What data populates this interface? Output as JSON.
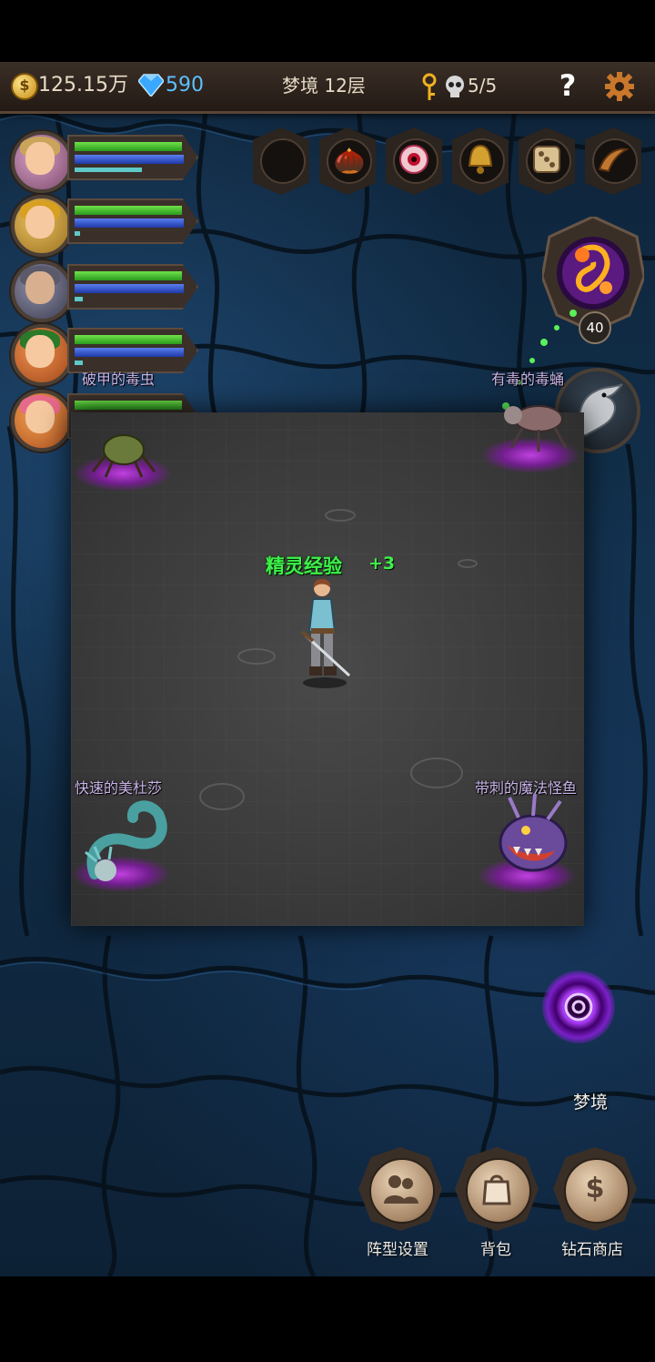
{
  "topbar": {
    "gold": "125.15万",
    "diamonds": "590",
    "floor": "梦境 12层",
    "keys": "5/5",
    "help": "?"
  },
  "party": {
    "heroes": [
      {
        "name": "hero-1",
        "hp": 0.95,
        "mp": 0.98,
        "xp": 0.55
      },
      {
        "name": "hero-2",
        "hp": 0.95,
        "mp": 0.98,
        "xp": 0.05
      },
      {
        "name": "hero-3",
        "hp": 0.95,
        "mp": 0.98,
        "xp": 0.07
      },
      {
        "name": "hero-4",
        "hp": 0.95,
        "mp": 0.98,
        "xp": 0.07
      },
      {
        "name": "hero-5",
        "hp": 0.95,
        "mp": 0.98,
        "xp": 0.02
      }
    ]
  },
  "skill_slots": [
    "empty-slot-icon",
    "acorn-icon",
    "eye-icon",
    "bell-icon",
    "dice-icon",
    "horn-icon"
  ],
  "spirit": {
    "level": "40"
  },
  "monsters": {
    "top_left": "破甲的毒虫",
    "top_right": "有毒的毒蛹",
    "bottom_left": "快速的美杜莎",
    "bottom_right": "带刺的魔法怪鱼"
  },
  "floating_text": {
    "label": "精灵经验",
    "value": "+3"
  },
  "portal": {
    "label": "梦境"
  },
  "bottom_buttons": {
    "formation": "阵型设置",
    "bag": "背包",
    "shop": "钻石商店"
  },
  "colors": {
    "hp": "#3cc82a",
    "mp": "#2a4ad0",
    "xp_text": "#3ef04a",
    "monster_name": "#c8b4e8"
  }
}
